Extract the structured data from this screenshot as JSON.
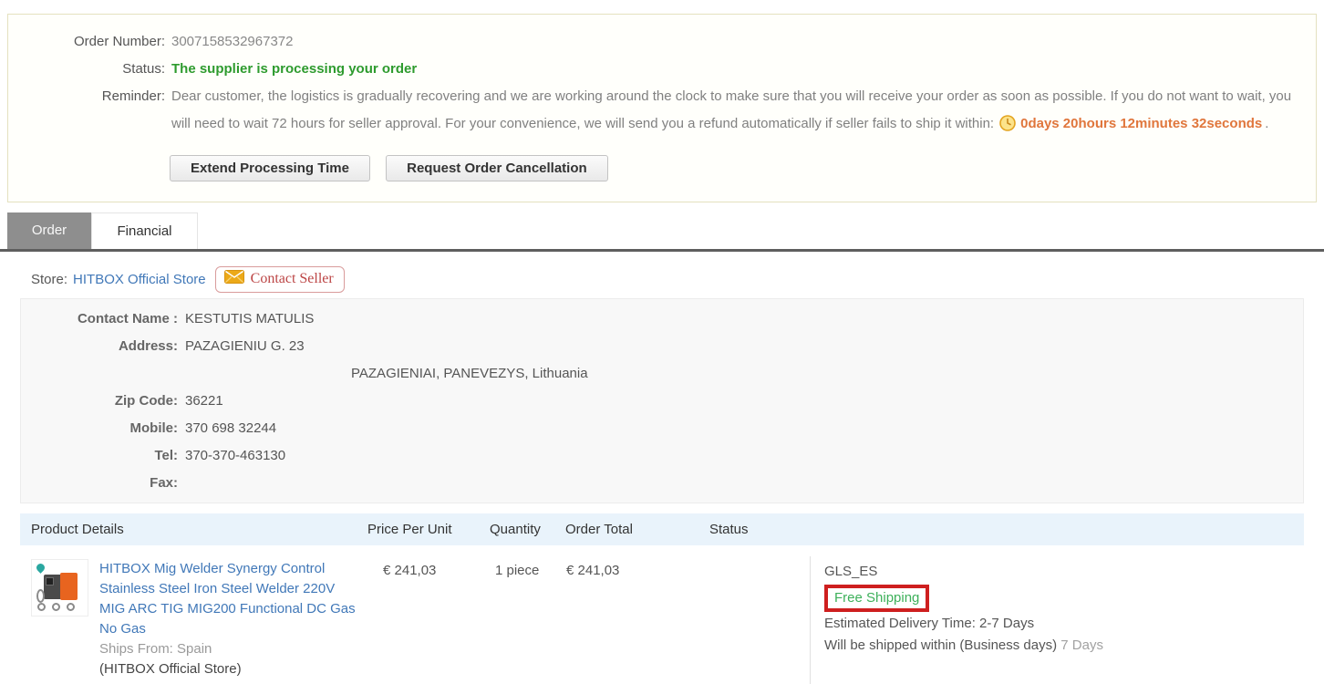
{
  "colors": {
    "status_green": "#2e9b2e",
    "countdown_orange": "#e0763c",
    "link_blue": "#4178b8",
    "free_shipping_green": "#3db05a",
    "annotation_red": "#ce1f1f",
    "tab_active_bg": "#8e8e8e",
    "table_header_bg": "#e9f3fb"
  },
  "icons": {
    "countdown": "clock-icon",
    "contact_seller": "envelope-icon"
  },
  "summary": {
    "order_number_label": "Order Number:",
    "order_number": "3007158532967372",
    "status_label": "Status:",
    "status_text": "The supplier is processing your order",
    "reminder_label": "Reminder:",
    "reminder_text": "Dear customer, the logistics is gradually recovering and we are working around the clock to make sure that you will receive your order as soon as possible. If you do not want to wait, you will need to wait 72 hours for seller approval. For your convenience, we will send you a refund automatically if seller fails to ship it within:",
    "countdown_text": "0days 20hours 12minutes 32seconds",
    "countdown_suffix": ".",
    "extend_button": "Extend Processing Time",
    "cancel_button": "Request Order Cancellation"
  },
  "tabs": {
    "order": "Order",
    "financial": "Financial"
  },
  "store": {
    "label": "Store:",
    "name": "HITBOX Official Store",
    "contact_seller_label": "Contact Seller"
  },
  "contact": {
    "rows": [
      {
        "label": "Contact Name :",
        "value": "KESTUTIS MATULIS"
      },
      {
        "label": "Address:",
        "value": "PAZAGIENIU G. 23"
      },
      {
        "label": "",
        "value": "PAZAGIENIAI, PANEVEZYS, Lithuania"
      },
      {
        "label": "Zip Code:",
        "value": "36221"
      },
      {
        "label": "Mobile:",
        "value": "370 698 32244"
      },
      {
        "label": "Tel:",
        "value": "370-370-463130"
      },
      {
        "label": "Fax:",
        "value": ""
      }
    ]
  },
  "table": {
    "headers": [
      "Product Details",
      "Price Per Unit",
      "Quantity",
      "Order Total",
      "Status"
    ]
  },
  "product": {
    "title": "HITBOX Mig Welder Synergy Control Stainless Steel Iron Steel Welder 220V MIG ARC TIG MIG200 Functional DC Gas No Gas",
    "ships_from": "Ships From: Spain",
    "store_note": "(HITBOX Official Store)",
    "price_per_unit": "€ 241,03",
    "quantity": "1 piece",
    "order_total": "€ 241,03",
    "shipping": {
      "carrier": "GLS_ES",
      "free_shipping": "Free Shipping",
      "estimated_delivery": "Estimated Delivery Time: 2-7 Days",
      "ship_within": "Will be shipped within (Business days)",
      "ship_within_days": "7 Days"
    }
  }
}
